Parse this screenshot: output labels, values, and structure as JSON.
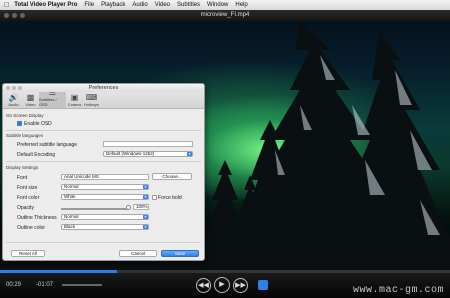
{
  "menubar": {
    "apple_icon": "apple-icon",
    "app_name": "Total Video Player Pro",
    "items": [
      "File",
      "Playback",
      "Audio",
      "Video",
      "Subtitles",
      "Window",
      "Help"
    ]
  },
  "player": {
    "window_title": "microview_FI.mp4",
    "progress_fraction": 0.26,
    "time_elapsed": "00:29",
    "time_remaining": "-01:07",
    "watermark": "www.mac-gm.com",
    "accent_color": "#2f7fe6"
  },
  "preferences": {
    "title": "Preferences",
    "tabs": [
      {
        "label": "Audio",
        "icon": "speaker-icon"
      },
      {
        "label": "Video",
        "icon": "camera-icon"
      },
      {
        "label": "Subtitles / OSD",
        "icon": "text-icon"
      },
      {
        "label": "Codecs",
        "icon": "chip-icon"
      },
      {
        "label": "Hotkeys",
        "icon": "keyboard-icon"
      }
    ],
    "active_tab": "Subtitles / OSD",
    "osd_section": "On Screen Display",
    "enable_osd_label": "Enable OSD",
    "enable_osd_checked": true,
    "subtitle_languages_section": "Subtitle languages",
    "preferred_language_label": "Preferred subtitle language",
    "preferred_language_value": "",
    "default_encoding_label": "Default Encoding",
    "default_encoding_value": "Default (Windows-1252)",
    "display_settings_section": "Display Settings",
    "font_label": "Font",
    "font_value": "Arial Unicode MS",
    "choose_button": "Choose...",
    "font_size_label": "Font size",
    "font_size_value": "Normal",
    "font_color_label": "Font color",
    "font_color_value": "White",
    "force_bold_label": "Force bold",
    "force_bold_checked": false,
    "opacity_label": "Opacity",
    "opacity_value": "100%",
    "opacity_fraction": 1.0,
    "outline_thickness_label": "Outline Thickness",
    "outline_thickness_value": "Normal",
    "outline_color_label": "Outline color",
    "outline_color_value": "Black",
    "reset_button": "Reset All",
    "cancel_button": "Cancel",
    "save_button": "Save"
  }
}
